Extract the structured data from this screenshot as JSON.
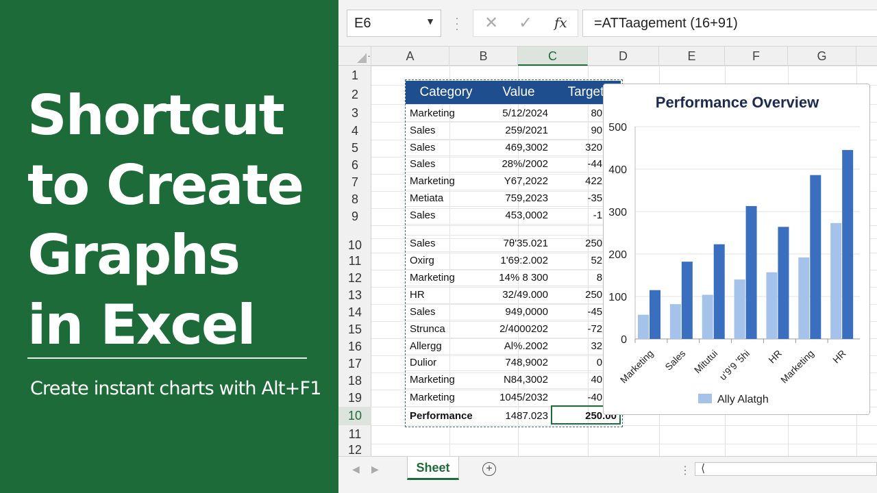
{
  "banner": {
    "title_lines": [
      "Shortcut",
      "to Create",
      "Graphs",
      "in Excel"
    ],
    "subtitle": "Create instant charts with Alt+F1"
  },
  "formula_bar": {
    "name_box": "E6",
    "formula": "=ATTaagement (16+91)",
    "fx": "fx"
  },
  "columns": [
    "A",
    "B",
    "C",
    "D",
    "E",
    "F",
    "G"
  ],
  "rows": [
    "1",
    "2",
    "3",
    "4",
    "5",
    "6",
    "7",
    "8",
    "9",
    "",
    "10",
    "11",
    "12",
    "13",
    "14",
    "15",
    "16",
    "17",
    "18",
    "19",
    "10",
    "11",
    "12"
  ],
  "table": {
    "headers": [
      "Category",
      "Value",
      "Target"
    ],
    "rows": [
      [
        "Marketing",
        "5/12/2024",
        "80.00"
      ],
      [
        "Sales",
        "259/2021",
        "90.00"
      ],
      [
        "Sales",
        "469,3002",
        "320.00"
      ],
      [
        "Sales",
        "28%/2002",
        "-44.00"
      ],
      [
        "Marketing",
        "Y67,2022",
        "422.00"
      ],
      [
        "Metiata",
        "759,2023",
        "-35.00"
      ],
      [
        "Sales",
        "453,0002",
        "-1.00"
      ],
      [
        "",
        "",
        ""
      ],
      [
        "Sales",
        "7θ'35.021",
        "250.00"
      ],
      [
        "Oxirg",
        "1'69:2.002",
        "52.00"
      ],
      [
        "Marketing",
        "14% 8 300",
        "8.00"
      ],
      [
        "HR",
        "32/49.000",
        "250.00"
      ],
      [
        "Sales",
        "949,0000",
        "-45.00"
      ],
      [
        "Strunca",
        "2/4000202",
        "-72.00"
      ],
      [
        "Allergg",
        "Al%.2002",
        "32.00"
      ],
      [
        "Dulior",
        "748,9002",
        "0.00"
      ],
      [
        "Marketing",
        "N84,3002",
        "40.00"
      ],
      [
        "Marketing",
        "1045/2032",
        "-40.00"
      ],
      [
        "Performance",
        "1487.023",
        "250.00"
      ]
    ]
  },
  "chart_data": {
    "type": "bar",
    "title": "Performance Overview",
    "categories": [
      "Marketing",
      "Sales",
      "Mitutui",
      "uʻ9ʻ9 ʻ5hi",
      "HR",
      "Marketing",
      "HR"
    ],
    "series": [
      {
        "name": "Ally Alatgh",
        "color": "#a4c2ea",
        "values": [
          57,
          82,
          104,
          140,
          157,
          192,
          273
        ]
      },
      {
        "name": "",
        "color": "#3a6fc0",
        "values": [
          115,
          182,
          223,
          313,
          264,
          386,
          445
        ]
      }
    ],
    "yticks": [
      "0",
      "100",
      "200",
      "300",
      "400",
      "500"
    ],
    "ylim": [
      0,
      500
    ],
    "grid": true,
    "legend": "bottom"
  },
  "sheet_bar": {
    "tab": "Sheet",
    "add": "+",
    "dots": "⋮"
  },
  "colors": {
    "banner": "#1e6b3a",
    "table_header": "#1f4e8f",
    "accent": "#1e6b3a"
  }
}
